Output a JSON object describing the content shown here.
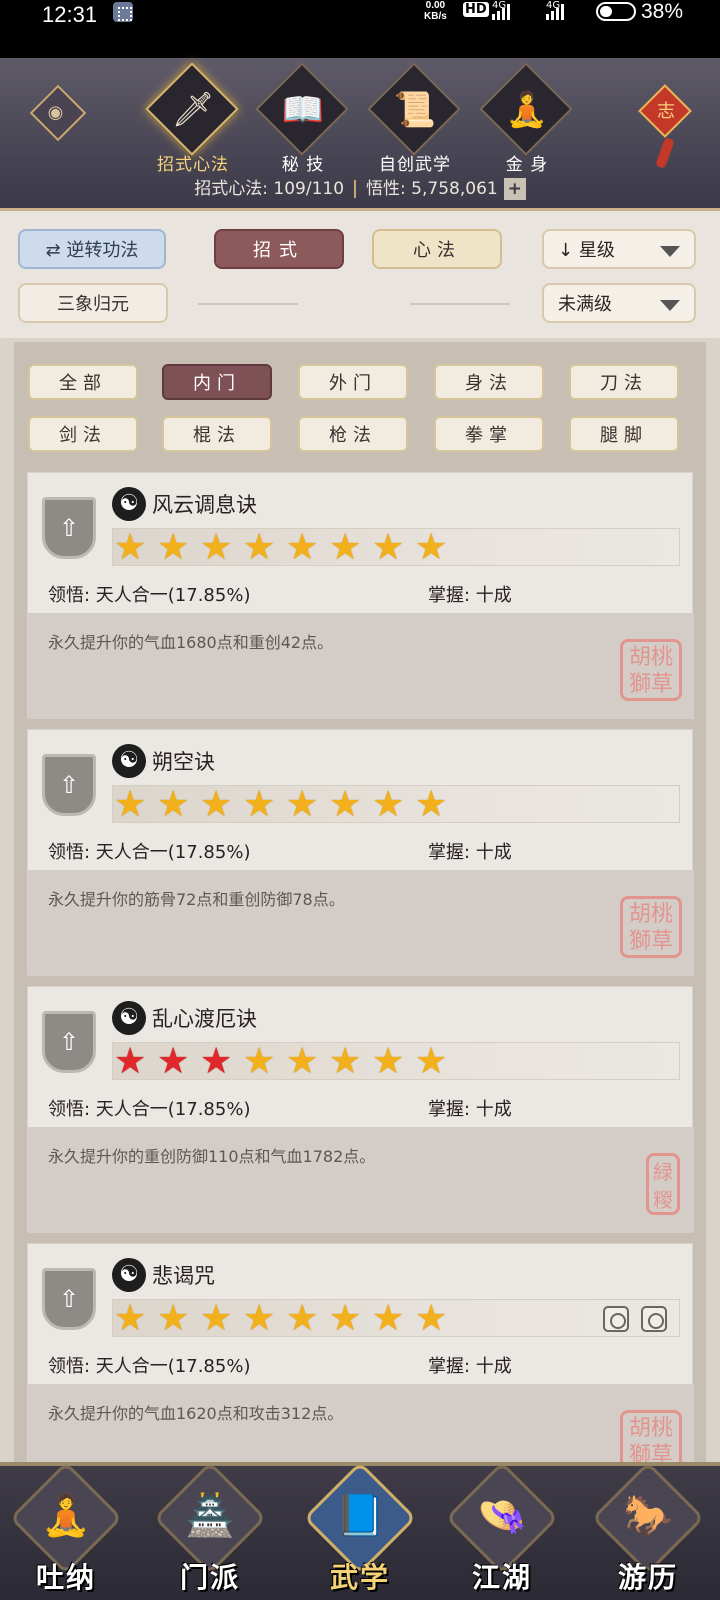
{
  "status_bar": {
    "time": "12:31",
    "net_speed": "0.00",
    "net_unit": "KB/s",
    "hd": "HD",
    "sig1": "4G",
    "sig2": "4G",
    "battery": "38%"
  },
  "top_nav": {
    "tabs": [
      {
        "label": "招式心法",
        "icon": "sword-icon",
        "glyph": "🗡"
      },
      {
        "label": "秘 技",
        "icon": "book-icon",
        "glyph": "📖"
      },
      {
        "label": "自创武学",
        "icon": "scroll-icon",
        "glyph": "📜"
      },
      {
        "label": "金 身",
        "icon": "meditation-icon",
        "glyph": "🧘"
      }
    ],
    "knot_text": "志",
    "stats_label": "招式心法: 109/110",
    "wuxing_label": "悟性: 5,758,061",
    "plus": "+"
  },
  "filters": {
    "reverse": "逆转功法",
    "reverse_icon": "⇄",
    "zhaoshi": "招式",
    "xinfa": "心法",
    "sort": "星级",
    "sort_icon": "↓",
    "sanxiang": "三象归元",
    "level": "未满级"
  },
  "categories": [
    "全部",
    "内门",
    "外门",
    "身法",
    "刀法",
    "剑法",
    "棍法",
    "枪法",
    "拳掌",
    "腿脚"
  ],
  "cards": [
    {
      "name": "风云调息诀",
      "red_stars": 0,
      "total_stars": 8,
      "lingwu": "领悟: 天人合一(17.85%)",
      "zhangwo": "掌握: 十成",
      "desc": "永久提升你的气血1680点和重创42点。",
      "seal": "胡桃\n獅草"
    },
    {
      "name": "朔空诀",
      "red_stars": 0,
      "total_stars": 8,
      "lingwu": "领悟: 天人合一(17.85%)",
      "zhangwo": "掌握: 十成",
      "desc": "永久提升你的筋骨72点和重创防御78点。",
      "seal": "胡桃\n獅草"
    },
    {
      "name": "乱心渡厄诀",
      "red_stars": 3,
      "total_stars": 8,
      "lingwu": "领悟: 天人合一(17.85%)",
      "zhangwo": "掌握: 十成",
      "desc": "永久提升你的重创防御110点和气血1782点。",
      "seal": "緑\n糉"
    },
    {
      "name": "悲谒咒",
      "red_stars": 0,
      "total_stars": 8,
      "lingwu": "领悟: 天人合一(17.85%)",
      "zhangwo": "掌握: 十成",
      "desc": "永久提升你的气血1620点和攻击312点。",
      "seal": "胡桃\n獅草"
    }
  ],
  "bottom_nav": [
    {
      "label": "吐纳",
      "icon": "monk-icon",
      "glyph": "🧘"
    },
    {
      "label": "门派",
      "icon": "banner-icon",
      "glyph": "🏯"
    },
    {
      "label": "武学",
      "icon": "manual-icon",
      "glyph": "📘"
    },
    {
      "label": "江湖",
      "icon": "straw-hat-icon",
      "glyph": "👒"
    },
    {
      "label": "游历",
      "icon": "horse-icon",
      "glyph": "🐎"
    }
  ]
}
